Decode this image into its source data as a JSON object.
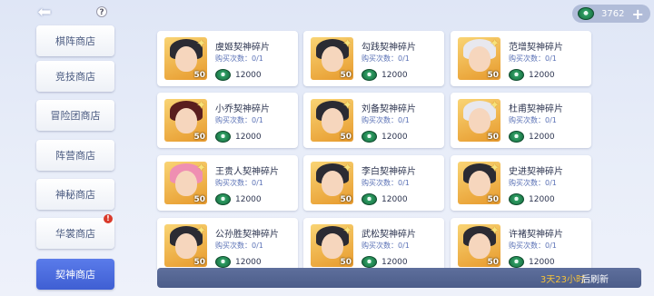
{
  "header": {
    "back_icon": "back-arrow-icon",
    "help_label": "?",
    "currency": {
      "icon": "jade-icon",
      "amount": "3762",
      "plus": "+"
    }
  },
  "sidebar": {
    "items": [
      {
        "label": "棋阵商店",
        "active": false,
        "badge": ""
      },
      {
        "label": "竞技商店",
        "active": false,
        "badge": ""
      },
      {
        "label": "冒险团商店",
        "active": false,
        "badge": ""
      },
      {
        "label": "阵营商店",
        "active": false,
        "badge": ""
      },
      {
        "label": "神秘商店",
        "active": false,
        "badge": ""
      },
      {
        "label": "华裳商店",
        "active": false,
        "badge": "!"
      },
      {
        "label": "契神商店",
        "active": true,
        "badge": ""
      }
    ]
  },
  "items": [
    {
      "name": "虞姬契神碎片",
      "buy": "购买次数：0/1",
      "qty": "50",
      "price": "12000",
      "hair": "dark"
    },
    {
      "name": "勾践契神碎片",
      "buy": "购买次数：0/1",
      "qty": "50",
      "price": "12000",
      "hair": "dark"
    },
    {
      "name": "范增契神碎片",
      "buy": "购买次数：0/1",
      "qty": "50",
      "price": "12000",
      "hair": "white"
    },
    {
      "name": "小乔契神碎片",
      "buy": "购买次数：0/1",
      "qty": "50",
      "price": "12000",
      "hair": "red"
    },
    {
      "name": "刘备契神碎片",
      "buy": "购买次数：0/1",
      "qty": "50",
      "price": "12000",
      "hair": "dark"
    },
    {
      "name": "杜甫契神碎片",
      "buy": "购买次数：0/1",
      "qty": "50",
      "price": "12000",
      "hair": "white"
    },
    {
      "name": "王贵人契神碎片",
      "buy": "购买次数：0/1",
      "qty": "50",
      "price": "12000",
      "hair": "pink"
    },
    {
      "name": "李白契神碎片",
      "buy": "购买次数：0/1",
      "qty": "50",
      "price": "12000",
      "hair": "dark"
    },
    {
      "name": "史进契神碎片",
      "buy": "购买次数：0/1",
      "qty": "50",
      "price": "12000",
      "hair": "dark"
    },
    {
      "name": "公孙胜契神碎片",
      "buy": "购买次数：0/1",
      "qty": "50",
      "price": "12000",
      "hair": "dark"
    },
    {
      "name": "武松契神碎片",
      "buy": "购买次数：0/1",
      "qty": "50",
      "price": "12000",
      "hair": "dark"
    },
    {
      "name": "许褚契神碎片",
      "buy": "购买次数：0/1",
      "qty": "50",
      "price": "12000",
      "hair": "dark"
    }
  ],
  "footer": {
    "refresh_time": "3天23小时",
    "refresh_suffix": "后刷新"
  },
  "colors": {
    "accent": "#4a6ae0",
    "jade": "#2f9e63",
    "footer_bg": "#55668f",
    "timer": "#f5c23a"
  }
}
